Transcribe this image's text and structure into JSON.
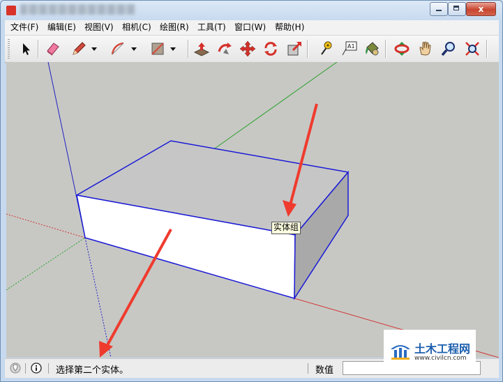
{
  "window": {
    "title": "",
    "controls": {
      "minimize": "—",
      "maximize": "□",
      "close": "x"
    }
  },
  "menu": {
    "items": [
      "文件(F)",
      "编辑(E)",
      "视图(V)",
      "相机(C)",
      "绘图(R)",
      "工具(T)",
      "窗口(W)",
      "帮助(H)"
    ]
  },
  "toolbar": {
    "tools": [
      "select-tool",
      "eraser-tool",
      "pencil-line-tool",
      "arc-tool",
      "rectangle-tool",
      "push-pull-tool",
      "follow-me-tool",
      "move-tool",
      "rotate-tool",
      "scale-tool",
      "tape-measure-tool",
      "text-tool",
      "paint-bucket-tool",
      "orbit-tool",
      "pan-tool",
      "zoom-tool",
      "zoom-extents-tool"
    ],
    "text_tool_glyph": "A1"
  },
  "viewport": {
    "tooltip": "实体组",
    "colors": {
      "background": "#c7c8c4",
      "edge": "#1a1ad6",
      "top_face": "#c6c6c6",
      "front_face": "#ffffff",
      "side_face": "#a9a9a9",
      "annotation_arrow": "#ef3b2e",
      "red_axis": "#d23232",
      "green_axis": "#2aa02a",
      "blue_axis": "#2020c0"
    }
  },
  "status": {
    "message": "选择第二个实体。",
    "measure_label": "数值",
    "measure_value": ""
  },
  "watermark": {
    "title": "土木工程网",
    "url": "www.civilcn.com"
  }
}
